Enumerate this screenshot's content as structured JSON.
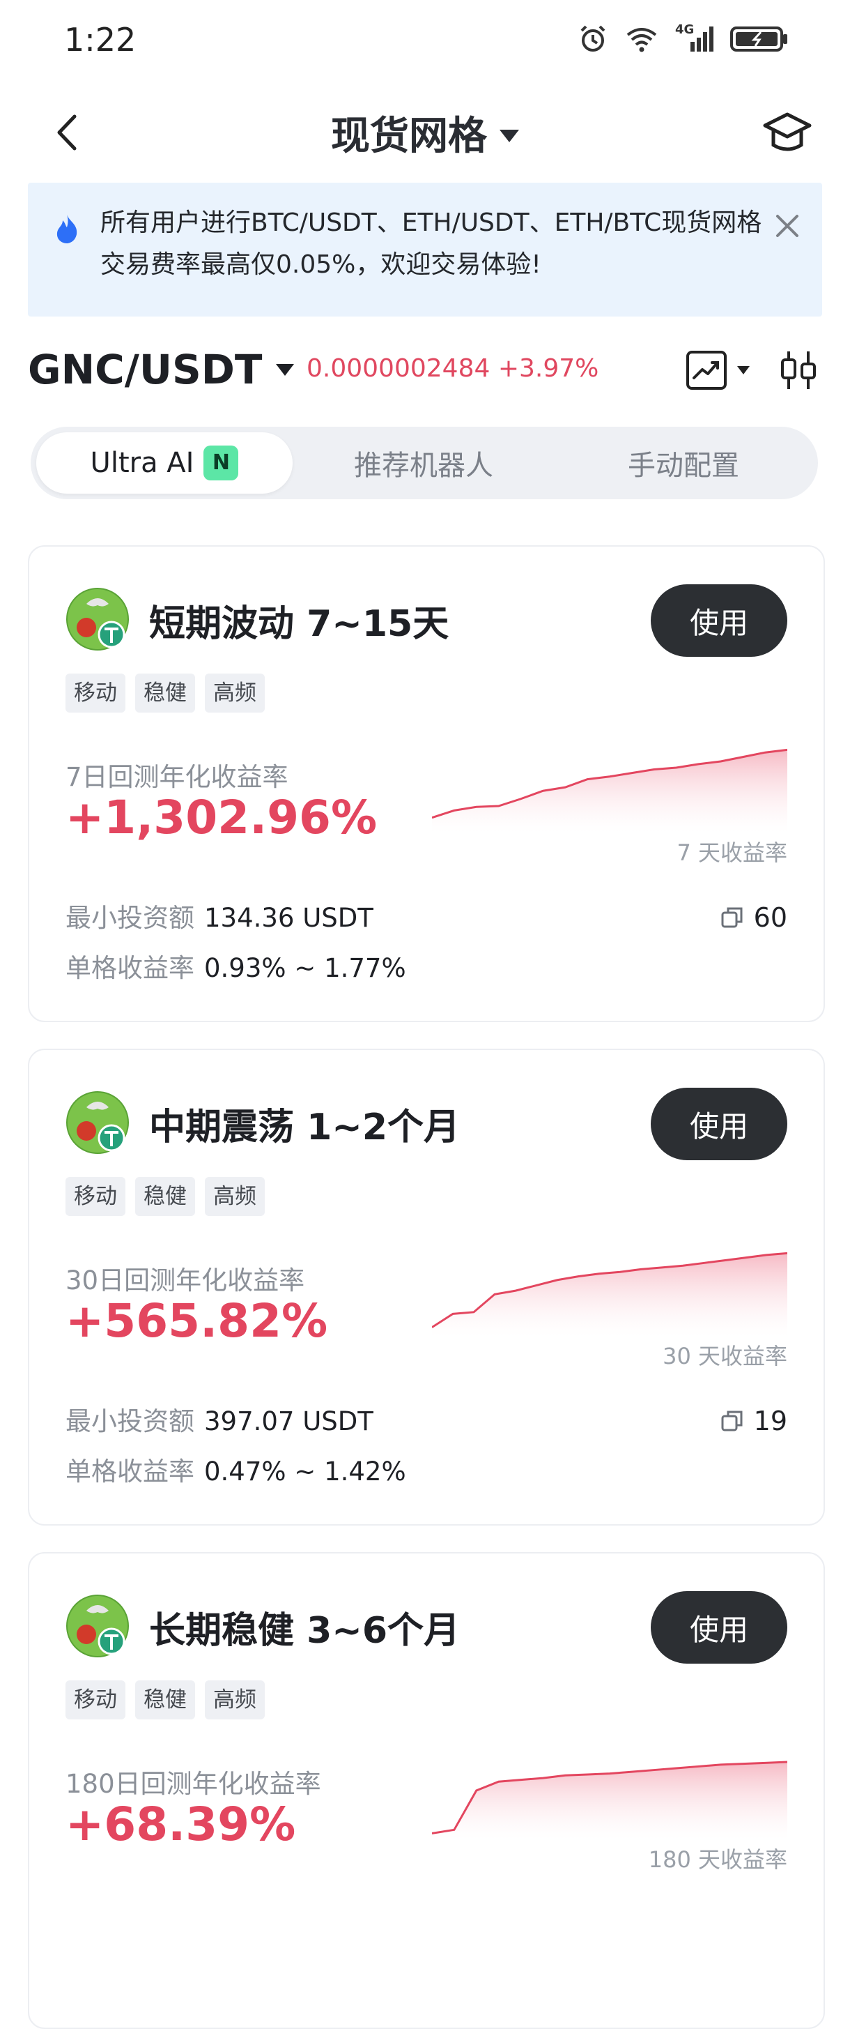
{
  "status": {
    "time": "1:22",
    "network": "4G"
  },
  "header": {
    "title": "现货网格"
  },
  "banner": {
    "text": "所有用户进行BTC/USDT、ETH/USDT、ETH/BTC现货网格交易费率最高仅0.05%，欢迎交易体验!"
  },
  "pair": {
    "symbol": "GNC/USDT",
    "price": "0.0000002484",
    "change": "+3.97%"
  },
  "tabs": [
    {
      "label": "Ultra AI",
      "badge": "N",
      "active": true
    },
    {
      "label": "推荐机器人",
      "active": false
    },
    {
      "label": "手动配置",
      "active": false
    }
  ],
  "cards": [
    {
      "title": "短期波动 7~15天",
      "use_label": "使用",
      "tags": [
        "移动",
        "稳健",
        "高频"
      ],
      "return_label": "7日回测年化收益率",
      "return_value": "+1,302.96%",
      "spark_label": "7 天收益率",
      "min_invest_label": "最小投资额",
      "min_invest_value": "134.36 USDT",
      "grid_return_label": "单格收益率",
      "grid_return_value": "0.93% ~ 1.77%",
      "copies": "60",
      "spark": [
        0.12,
        0.2,
        0.24,
        0.25,
        0.33,
        0.42,
        0.46,
        0.55,
        0.58,
        0.62,
        0.66,
        0.68,
        0.72,
        0.75,
        0.8,
        0.85,
        0.88
      ]
    },
    {
      "title": "中期震荡 1~2个月",
      "use_label": "使用",
      "tags": [
        "移动",
        "稳健",
        "高频"
      ],
      "return_label": "30日回测年化收益率",
      "return_value": "+565.82%",
      "spark_label": "30 天收益率",
      "min_invest_label": "最小投资额",
      "min_invest_value": "397.07 USDT",
      "grid_return_label": "单格收益率",
      "grid_return_value": "0.47% ~ 1.42%",
      "copies": "19",
      "spark": [
        0.05,
        0.2,
        0.22,
        0.42,
        0.46,
        0.52,
        0.58,
        0.62,
        0.65,
        0.67,
        0.7,
        0.72,
        0.74,
        0.77,
        0.8,
        0.83,
        0.86,
        0.88
      ]
    },
    {
      "title": "长期稳健 3~6个月",
      "use_label": "使用",
      "tags": [
        "移动",
        "稳健",
        "高频"
      ],
      "return_label": "180日回测年化收益率",
      "return_value": "+68.39%",
      "spark_label": "180 天收益率",
      "min_invest_label": "",
      "min_invest_value": "",
      "grid_return_label": "",
      "grid_return_value": "",
      "copies": "",
      "spark": [
        0.02,
        0.06,
        0.5,
        0.6,
        0.62,
        0.64,
        0.67,
        0.68,
        0.69,
        0.71,
        0.73,
        0.75,
        0.77,
        0.79,
        0.8,
        0.81,
        0.82
      ]
    }
  ],
  "colors": {
    "accent_red": "#e3465f",
    "dark_button": "#2c2f33",
    "banner_bg": "#eaf3fd",
    "badge_green": "#5ce6a6"
  }
}
